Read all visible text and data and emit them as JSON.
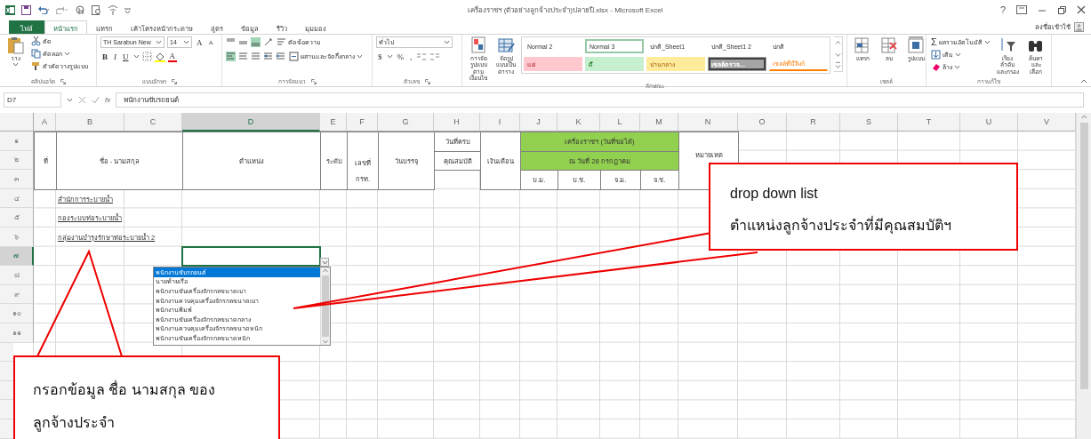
{
  "window": {
    "title": "เครื่องราชฯ (ตัวอย่างลูกจ้างประจำ)ปลายปี.xlsx - Microsoft Excel",
    "help": "?",
    "account": "ลงชื่อเข้าใช้"
  },
  "tabs": [
    {
      "label": "ไฟล์",
      "kind": "file",
      "selected": false
    },
    {
      "label": "หน้าแรก",
      "kind": "tab",
      "selected": true
    },
    {
      "label": "แทรก",
      "kind": "tab",
      "selected": false
    },
    {
      "label": "เค้าโครงหน้ากระดาษ",
      "kind": "tab",
      "selected": false
    },
    {
      "label": "สูตร",
      "kind": "tab",
      "selected": false
    },
    {
      "label": "ข้อมูล",
      "kind": "tab",
      "selected": false
    },
    {
      "label": "รีวิว",
      "kind": "tab",
      "selected": false
    },
    {
      "label": "มุมมอง",
      "kind": "tab",
      "selected": false
    }
  ],
  "ribbon": {
    "clipboard": {
      "paste": "วาง",
      "cut": "ตัด",
      "copy": "คัดลอก",
      "format_painter": "ตัวคัดวางรูปแบบ",
      "label": "คลิปบอร์ด"
    },
    "font": {
      "name": "TH Sarabun New",
      "size": "14",
      "grow": "A",
      "shrink": "A",
      "bold": "B",
      "italic": "I",
      "underline": "U",
      "font_color": "A",
      "label": "แบบอักษร"
    },
    "alignment": {
      "wrap": "ตัดข้อความ",
      "merge": "ผสานและจัดกึ่งกลาง",
      "label": "การจัดแนว"
    },
    "number": {
      "format": "ทั่วไป",
      "currency": "$",
      "percent": "%",
      "comma": ",",
      "label": "ตัวเลข"
    },
    "styles": {
      "conditional": "การจัดรูปแบบตามเงื่อนไข",
      "as_table": "จัดรูปแบบเป็นตาราง",
      "label": "ลักษณะ",
      "gallery": [
        {
          "label": "Normal 2",
          "kind": "normal",
          "selected": false
        },
        {
          "label": "Normal 3",
          "kind": "normal",
          "selected": true
        },
        {
          "label": "ปกติ_Sheet1",
          "kind": "normal",
          "selected": false
        },
        {
          "label": "ปกติ_Sheet1 2",
          "kind": "normal",
          "selected": false
        },
        {
          "label": "ปกติ",
          "kind": "normal",
          "selected": false
        },
        {
          "label": "แย่",
          "kind": "bad",
          "selected": false
        },
        {
          "label": "ดี",
          "kind": "good",
          "selected": false
        },
        {
          "label": "ปานกลาง",
          "kind": "neutral",
          "selected": false
        },
        {
          "label": "เซลล์ตรวจ...",
          "kind": "check",
          "selected": false
        },
        {
          "label": "เซลล์ที่มีลิงก์",
          "kind": "linked",
          "selected": false
        }
      ]
    },
    "cells": {
      "insert": "แทรก",
      "delete": "ลบ",
      "format": "รูปแบบ",
      "label": "เซลล์"
    },
    "editing": {
      "autosum_symbol": "Σ",
      "autosum": "ผลรวมอัตโนมัติ",
      "fill": "เติม",
      "clear": "ล้าง",
      "sort": "เรียงลำดับและกรอง",
      "find": "ค้นหาและเลือก",
      "label": "การแก้ไข"
    }
  },
  "formula_bar": {
    "name_box": "D7",
    "fx": "fx",
    "value": "พนักงานขับรถยนต์"
  },
  "sheet": {
    "columns": [
      {
        "letter": "A",
        "selected": false
      },
      {
        "letter": "B",
        "selected": false
      },
      {
        "letter": "C",
        "selected": false
      },
      {
        "letter": "D",
        "selected": true
      },
      {
        "letter": "E",
        "selected": false
      },
      {
        "letter": "F",
        "selected": false
      },
      {
        "letter": "G",
        "selected": false
      },
      {
        "letter": "H",
        "selected": false
      },
      {
        "letter": "I",
        "selected": false
      },
      {
        "letter": "J",
        "selected": false
      },
      {
        "letter": "K",
        "selected": false
      },
      {
        "letter": "L",
        "selected": false
      },
      {
        "letter": "M",
        "selected": false
      },
      {
        "letter": "N",
        "selected": false
      },
      {
        "letter": "O",
        "selected": false
      },
      {
        "letter": "R",
        "selected": false
      },
      {
        "letter": "S",
        "selected": false
      },
      {
        "letter": "T",
        "selected": false
      },
      {
        "letter": "U",
        "selected": false
      },
      {
        "letter": "V",
        "selected": false
      }
    ],
    "rows": [
      {
        "number": "๑",
        "selected": false
      },
      {
        "number": "๒",
        "selected": false
      },
      {
        "number": "๓",
        "selected": false
      },
      {
        "number": "๔",
        "selected": false
      },
      {
        "number": "๕",
        "selected": false
      },
      {
        "number": "๖",
        "selected": false
      },
      {
        "number": "๗",
        "selected": true
      },
      {
        "number": "๘",
        "selected": false
      },
      {
        "number": "๙",
        "selected": false
      },
      {
        "number": "๑๐",
        "selected": false
      },
      {
        "number": "๑๑",
        "selected": false
      }
    ],
    "header_cells": [
      {
        "kind": "header",
        "text": "ที่"
      },
      {
        "kind": "header",
        "text": "ชื่อ - นามสกุล"
      },
      {
        "kind": "header",
        "text": "ตำแหน่ง"
      },
      {
        "kind": "header",
        "text": "ระดับ"
      },
      {
        "kind": "header-low",
        "text": "เลขที่ กรท."
      },
      {
        "kind": "header",
        "text": "วันบรรจุ"
      },
      {
        "kind": "header",
        "text": "วันที่ครบ"
      },
      {
        "kind": "header",
        "text": "คุณสมบัติ"
      },
      {
        "kind": "header",
        "text": "เงินเดือน"
      },
      {
        "kind": "group",
        "text": "เครื่องราชฯ (วันที่ขอได้)"
      },
      {
        "kind": "group",
        "text": "ณ วันที่ 28 กรกฎาคม"
      },
      {
        "kind": "header",
        "text": "บ.ม."
      },
      {
        "kind": "header",
        "text": "บ.ช."
      },
      {
        "kind": "header",
        "text": "จ.ม."
      },
      {
        "kind": "header",
        "text": "จ.ช."
      },
      {
        "kind": "header-top",
        "text": "หมายเหต"
      }
    ],
    "departments": [
      "สำนักการระบายน้ำ",
      "กองระบบท่อระบายน้ำ",
      "กลุ่มงานบำรุงรักษาท่อระบายน้ำ 2"
    ]
  },
  "dropdown": {
    "items": [
      {
        "label": "พนักงานขับรถยนต์",
        "selected": true
      },
      {
        "label": "นายท้ายเรือ",
        "selected": false
      },
      {
        "label": "พนักงานขับเครื่องจักรกลขนาดเบา",
        "selected": false
      },
      {
        "label": "พนักงานควบคุมเครื่องจักรกลขนาดเบา",
        "selected": false
      },
      {
        "label": "พนักงานพิมพ์",
        "selected": false
      },
      {
        "label": "พนักงานขับเครื่องจักรกลขนาดกลาง",
        "selected": false
      },
      {
        "label": "พนักงานควบคุมเครื่องจักรกลขนาดหนัก",
        "selected": false
      },
      {
        "label": "พนักงานขับเครื่องจักรกลขนาดหนัก",
        "selected": false
      }
    ]
  },
  "callouts": [
    {
      "kind": "right",
      "lines": [
        "drop down list",
        "ตำแหน่งลูกจ้างประจำที่มีคุณสมบัติฯ"
      ]
    },
    {
      "kind": "left",
      "lines": [
        "กรอกข้อมูล ชื่อ นามสกุล ของ",
        "ลูกจ้างประจำ"
      ]
    }
  ]
}
